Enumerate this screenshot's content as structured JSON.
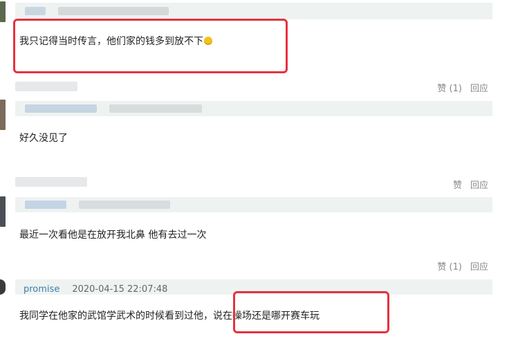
{
  "comments": [
    {
      "body": "我只记得当时传言，他们家的钱多到放不下",
      "like_label": "赞 (1)",
      "reply_label": "回应"
    },
    {
      "body": "好久没见了",
      "like_label": "赞",
      "reply_label": "回应"
    },
    {
      "body": "最近一次看他是在放开我北鼻 他有去过一次",
      "like_label": "赞 (1)",
      "reply_label": "回应"
    },
    {
      "author": "promise",
      "date": "2020-04-15 22:07:48",
      "body_part1": "我同学在他家的武馆学武术的时候看到过他，",
      "body_part2": "说在操场还是哪开赛车玩"
    }
  ],
  "colors": {
    "highlight": "#e5323f",
    "header_bg": "#eef3f1",
    "author": "#3a7fa8"
  },
  "icons": {
    "emoji": "grinning-face-icon"
  }
}
